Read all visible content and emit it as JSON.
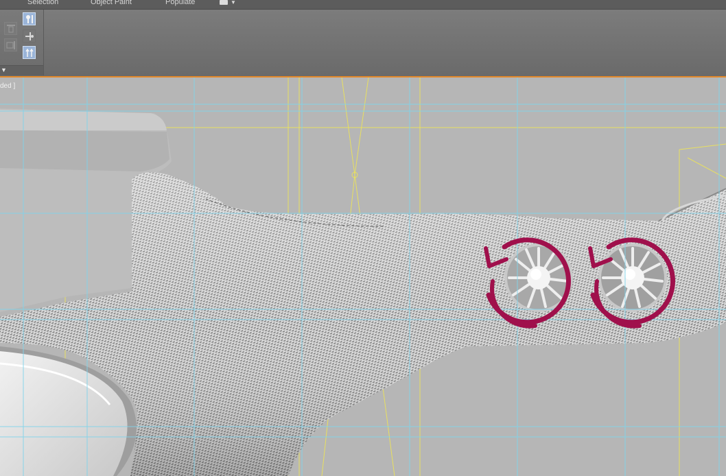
{
  "ribbon": {
    "tabs": [
      {
        "label": "Selection"
      },
      {
        "label": "Object Paint"
      },
      {
        "label": "Populate"
      }
    ]
  },
  "viewport": {
    "label": "ded ]"
  },
  "colors": {
    "ribbon_bg": "#6e6e6e",
    "accent_orange": "#e48a2a",
    "viewport_bg": "#b6b6b6",
    "grid_blue": "#7fd4ec",
    "guide_yellow": "#e8e060",
    "rotate_annotation": "#a0104c"
  },
  "icons": {
    "panel_buttons": [
      "align-top-icon",
      "align-left-icon",
      "pin-icon",
      "align-vertical-icon",
      "align-up-arrows-icon"
    ],
    "annotations": [
      "rotate-counterclockwise-icon",
      "rotate-counterclockwise-icon"
    ]
  }
}
